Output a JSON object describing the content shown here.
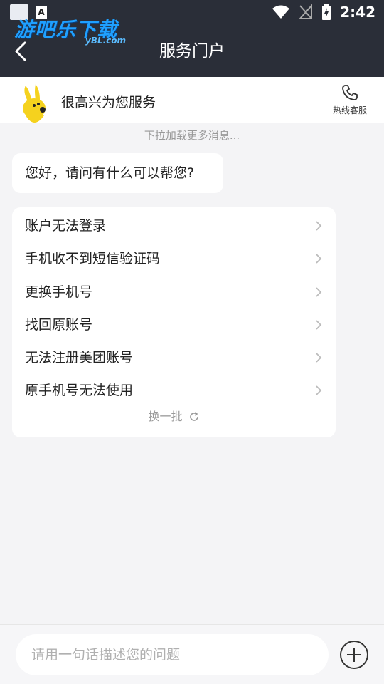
{
  "status_bar": {
    "time": "2:42",
    "notif_letter": "A"
  },
  "watermark": {
    "text": "游吧乐下载",
    "sub": "yBL.com"
  },
  "header": {
    "title": "服务门户"
  },
  "banner": {
    "greeting": "很高兴为您服务",
    "hotline_label": "热线客服"
  },
  "chat": {
    "load_more": "下拉加载更多消息...",
    "bot_message": "您好，请问有什么可以帮您?"
  },
  "menu": {
    "items": [
      {
        "label": "账户无法登录"
      },
      {
        "label": "手机收不到短信验证码"
      },
      {
        "label": "更换手机号"
      },
      {
        "label": "找回原账号"
      },
      {
        "label": "无法注册美团账号"
      },
      {
        "label": "原手机号无法使用"
      }
    ],
    "refresh_label": "换一批"
  },
  "composer": {
    "placeholder": "请用一句话描述您的问题"
  },
  "colors": {
    "header_bg": "#2a2e38",
    "page_bg": "#f4f4f6",
    "mascot_yellow": "#f5d21e"
  }
}
